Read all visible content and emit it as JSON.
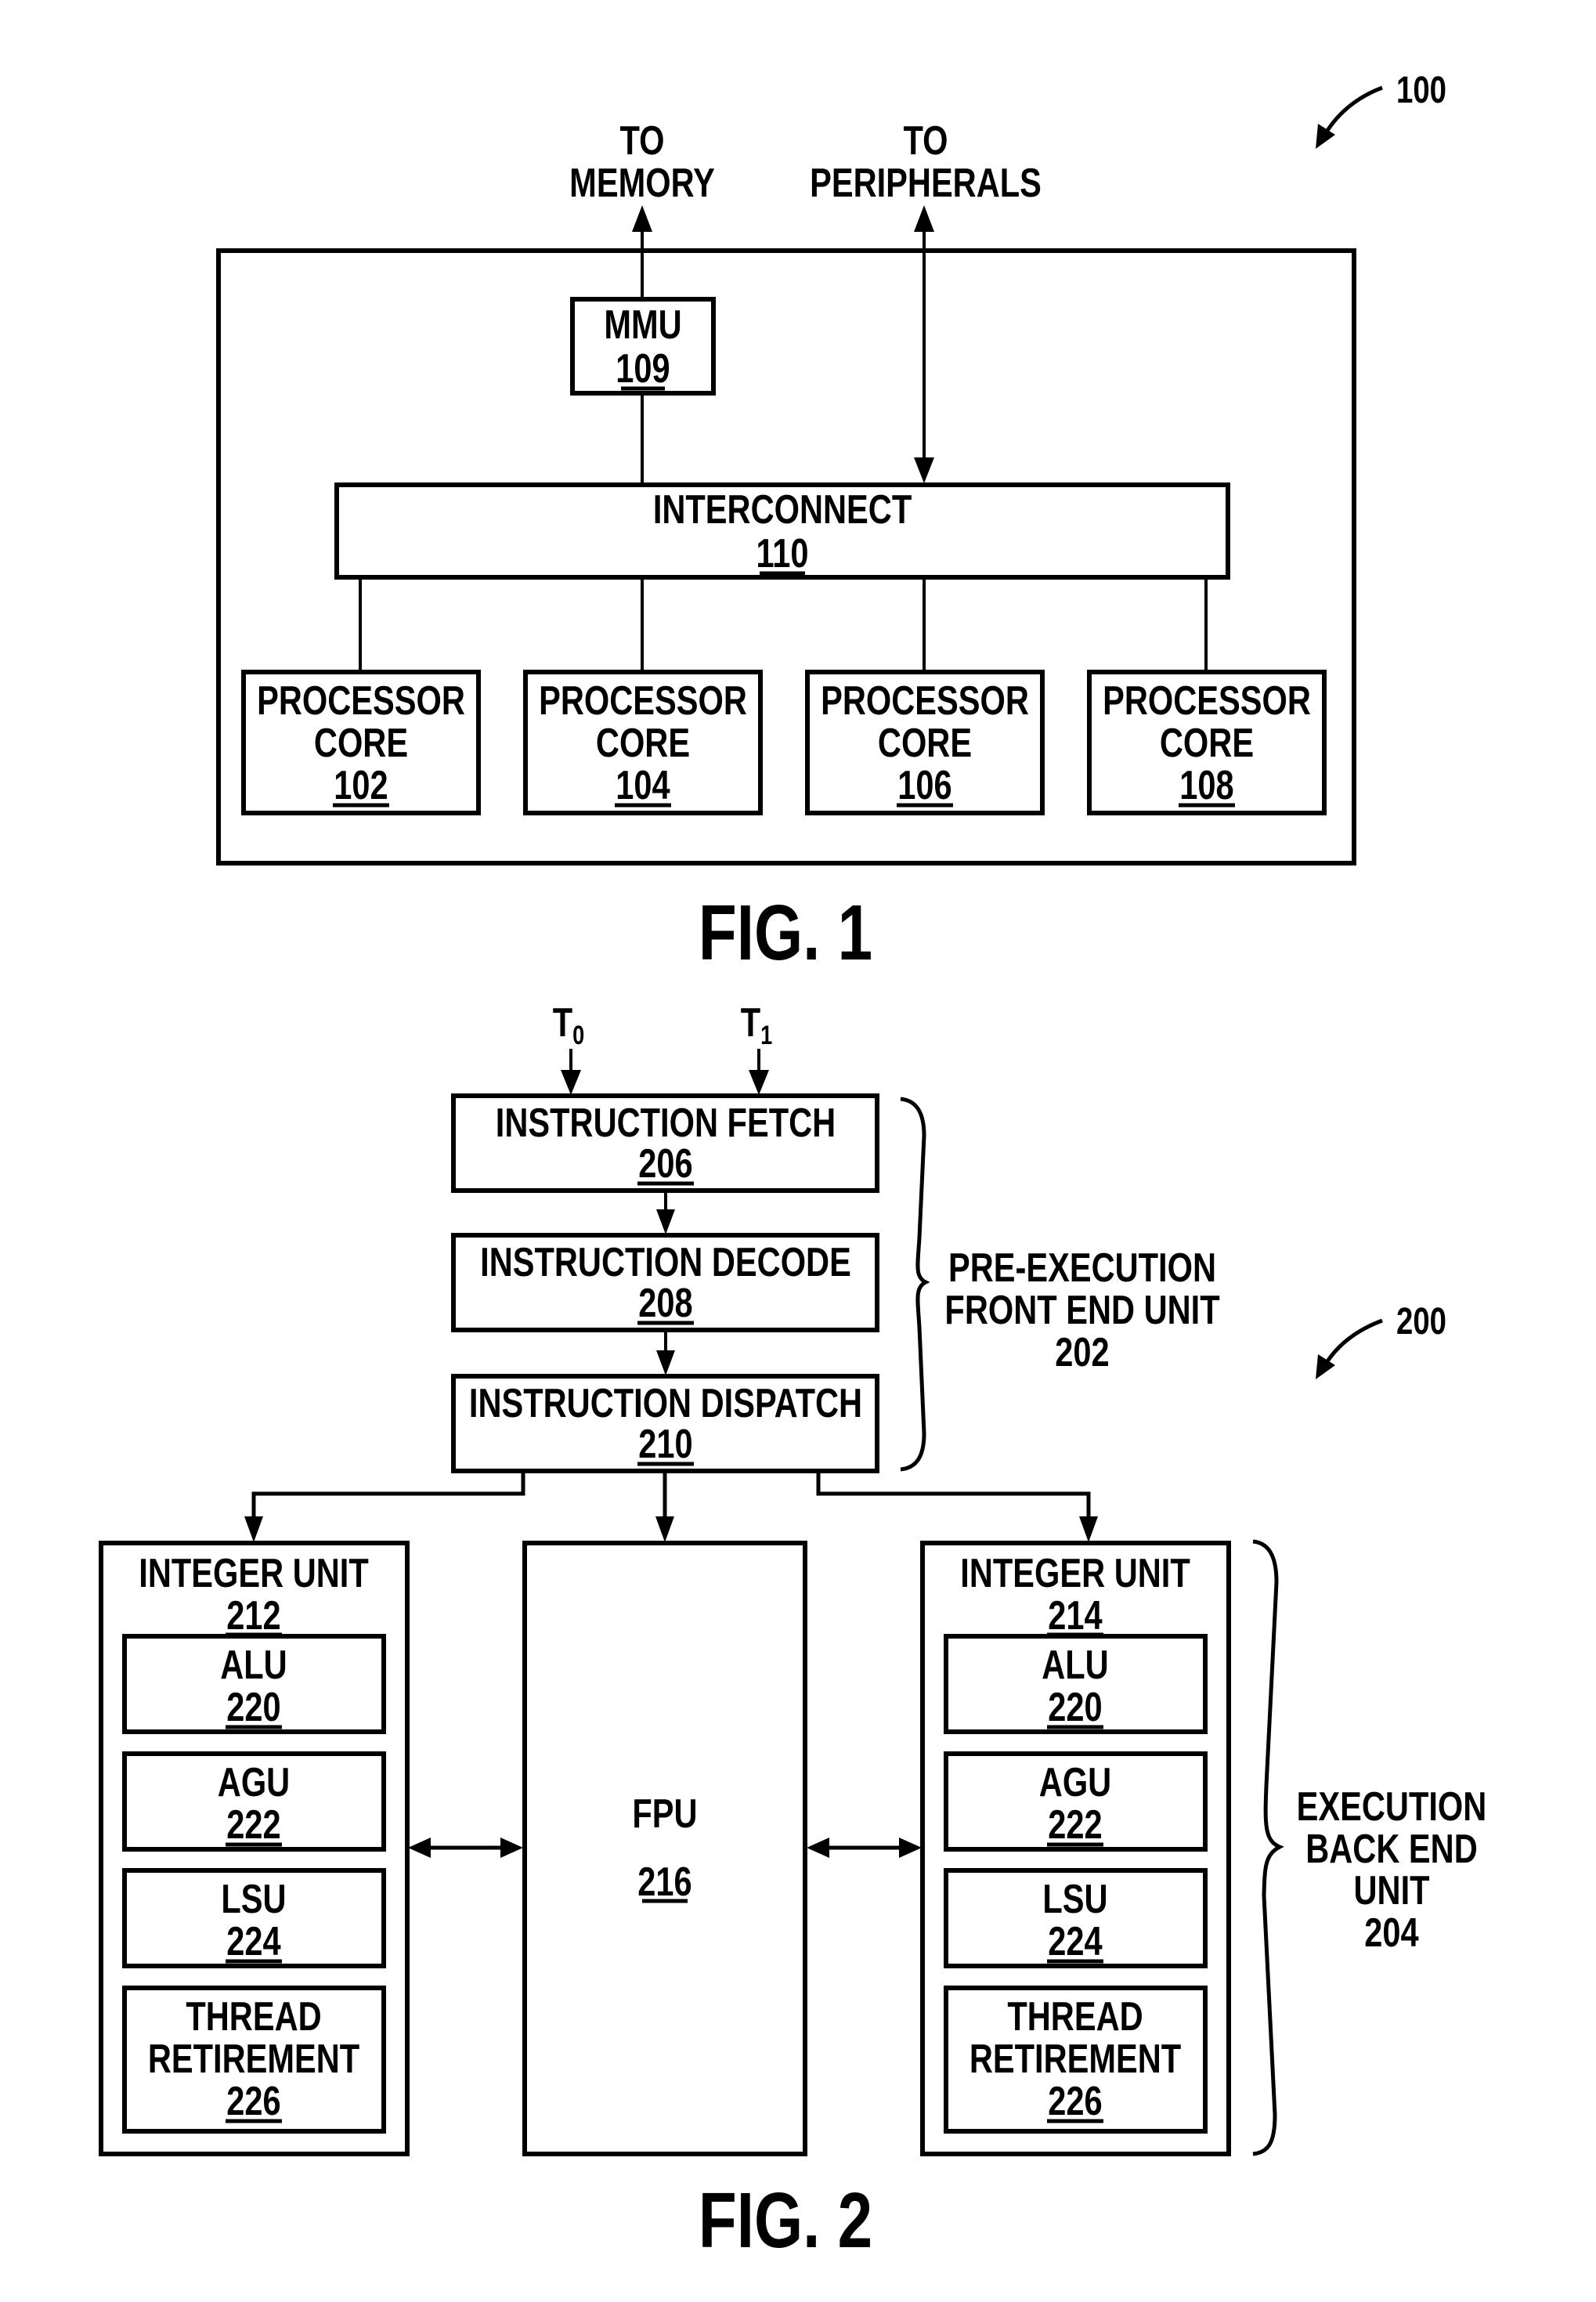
{
  "fig1": {
    "ref_label": "100",
    "caption": "FIG. 1",
    "to_memory": [
      "TO",
      "MEMORY"
    ],
    "to_peripherals": [
      "TO",
      "PERIPHERALS"
    ],
    "mmu": {
      "name": "MMU",
      "ref": "109"
    },
    "interconnect": {
      "name": "INTERCONNECT",
      "ref": "110"
    },
    "cores": [
      {
        "name": [
          "PROCESSOR",
          "CORE"
        ],
        "ref": "102"
      },
      {
        "name": [
          "PROCESSOR",
          "CORE"
        ],
        "ref": "104"
      },
      {
        "name": [
          "PROCESSOR",
          "CORE"
        ],
        "ref": "106"
      },
      {
        "name": [
          "PROCESSOR",
          "CORE"
        ],
        "ref": "108"
      }
    ]
  },
  "fig2": {
    "ref_label": "200",
    "caption": "FIG. 2",
    "threads": [
      {
        "base": "T",
        "sub": "0"
      },
      {
        "base": "T",
        "sub": "1"
      }
    ],
    "front_end": {
      "stages": [
        {
          "name": "INSTRUCTION FETCH",
          "ref": "206"
        },
        {
          "name": "INSTRUCTION DECODE",
          "ref": "208"
        },
        {
          "name": "INSTRUCTION DISPATCH",
          "ref": "210"
        }
      ],
      "label": [
        "PRE-EXECUTION",
        "FRONT END UNIT",
        "202"
      ]
    },
    "integer_units": [
      {
        "name": "INTEGER UNIT",
        "ref": "212",
        "subunits": [
          {
            "name": [
              "ALU"
            ],
            "ref": "220"
          },
          {
            "name": [
              "AGU"
            ],
            "ref": "222"
          },
          {
            "name": [
              "LSU"
            ],
            "ref": "224"
          },
          {
            "name": [
              "THREAD",
              "RETIREMENT"
            ],
            "ref": "226"
          }
        ]
      },
      {
        "name": "INTEGER UNIT",
        "ref": "214",
        "subunits": [
          {
            "name": [
              "ALU"
            ],
            "ref": "220"
          },
          {
            "name": [
              "AGU"
            ],
            "ref": "222"
          },
          {
            "name": [
              "LSU"
            ],
            "ref": "224"
          },
          {
            "name": [
              "THREAD",
              "RETIREMENT"
            ],
            "ref": "226"
          }
        ]
      }
    ],
    "fpu": {
      "name": "FPU",
      "ref": "216"
    },
    "back_end_label": [
      "EXECUTION",
      "BACK END",
      "UNIT",
      "204"
    ]
  }
}
